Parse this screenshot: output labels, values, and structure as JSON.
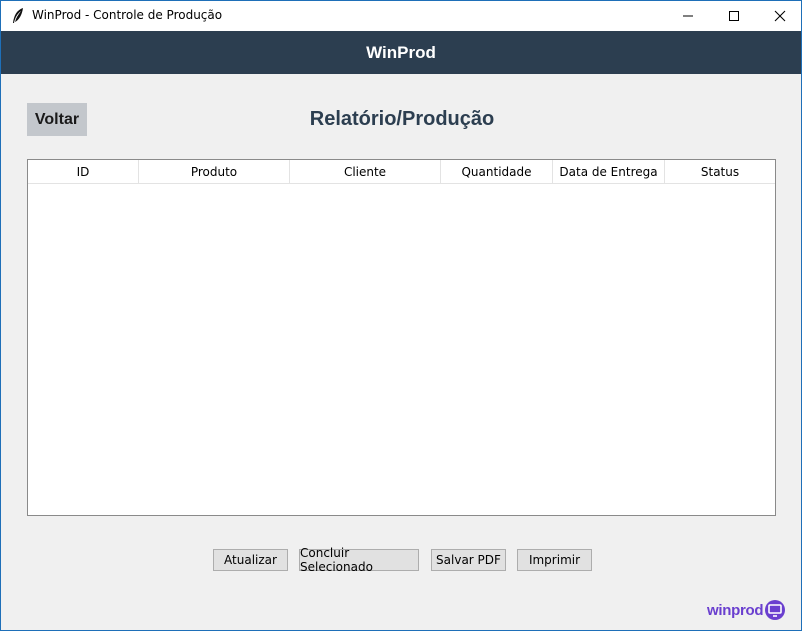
{
  "window": {
    "title": "WinProd - Controle de Produção",
    "icon": "feather-icon"
  },
  "header": {
    "brand": "WinProd",
    "color": "#2c3e50"
  },
  "page": {
    "back_label": "Voltar",
    "title": "Relatório/Produção"
  },
  "table": {
    "columns": [
      "ID",
      "Produto",
      "Cliente",
      "Quantidade",
      "Data de Entrega",
      "Status"
    ],
    "rows": []
  },
  "actions": {
    "refresh": "Atualizar",
    "complete_selected": "Concluir Selecionado",
    "save_pdf": "Salvar PDF",
    "print": "Imprimir"
  },
  "footer": {
    "logo_text": "winprod",
    "logo_color": "#6a3fcf"
  }
}
